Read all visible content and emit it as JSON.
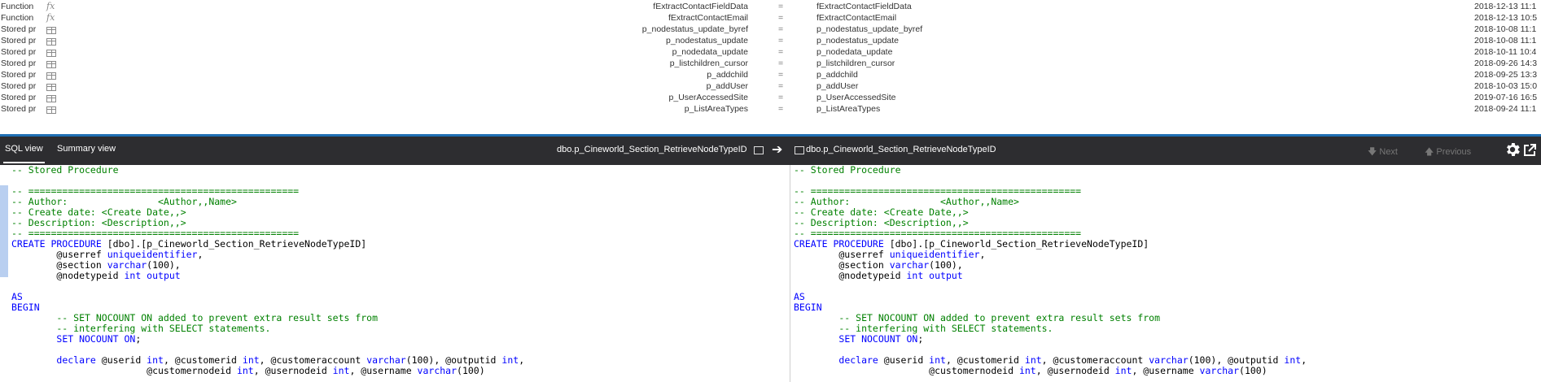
{
  "object_list": {
    "rows": [
      {
        "type": "Function",
        "icon": "fx",
        "left": "fExtractContactFieldData",
        "eq": "=",
        "right": "fExtractContactFieldData",
        "date": "2018-12-13 11:1"
      },
      {
        "type": "Function",
        "icon": "fx",
        "left": "fExtractContactEmail",
        "eq": "=",
        "right": "fExtractContactEmail",
        "date": "2018-12-13 10:5"
      },
      {
        "type": "Stored pr",
        "icon": "table",
        "left": "p_nodestatus_update_byref",
        "eq": "=",
        "right": "p_nodestatus_update_byref",
        "date": "2018-10-08 11:1"
      },
      {
        "type": "Stored pr",
        "icon": "table",
        "left": "p_nodestatus_update",
        "eq": "=",
        "right": "p_nodestatus_update",
        "date": "2018-10-08 11:1"
      },
      {
        "type": "Stored pr",
        "icon": "table",
        "left": "p_nodedata_update",
        "eq": "=",
        "right": "p_nodedata_update",
        "date": "2018-10-11 10:4"
      },
      {
        "type": "Stored pr",
        "icon": "table",
        "left": "p_listchildren_cursor",
        "eq": "=",
        "right": "p_listchildren_cursor",
        "date": "2018-09-26 14:3"
      },
      {
        "type": "Stored pr",
        "icon": "table",
        "left": "p_addchild",
        "eq": "=",
        "right": "p_addchild",
        "date": "2018-09-25 13:3"
      },
      {
        "type": "Stored pr",
        "icon": "table",
        "left": "p_addUser",
        "eq": "=",
        "right": "p_addUser",
        "date": "2018-10-03 15:0"
      },
      {
        "type": "Stored pr",
        "icon": "table",
        "left": "p_UserAccessedSite",
        "eq": "=",
        "right": "p_UserAccessedSite",
        "date": "2019-07-16 16:5"
      },
      {
        "type": "Stored pr",
        "icon": "table",
        "left": "p_ListAreaTypes",
        "eq": "=",
        "right": "p_ListAreaTypes",
        "date": "2018-09-24 11:1"
      }
    ]
  },
  "toolbar": {
    "tab_sql": "SQL view",
    "tab_summary": "Summary view",
    "left_object": "dbo.p_Cineworld_Section_RetrieveNodeTypeID",
    "right_object": "dbo.p_Cineworld_Section_RetrieveNodeTypeID",
    "next_label": "Next",
    "previous_label": "Previous"
  },
  "code_lines": [
    [
      {
        "t": "-- Stored Procedure",
        "c": "cm"
      }
    ],
    [
      {
        "t": "",
        "c": ""
      }
    ],
    [
      {
        "t": "-- ================================================",
        "c": "cm"
      }
    ],
    [
      {
        "t": "-- Author:\t\t<Author,,Name>",
        "c": "cm"
      }
    ],
    [
      {
        "t": "-- Create date: <Create Date,,>",
        "c": "cm"
      }
    ],
    [
      {
        "t": "-- Description: <Description,,>",
        "c": "cm"
      }
    ],
    [
      {
        "t": "-- ================================================",
        "c": "cm"
      }
    ],
    [
      {
        "t": "CREATE PROCEDURE",
        "c": "kw"
      },
      {
        "t": " [dbo].[p_Cineworld_Section_RetrieveNodeTypeID]",
        "c": ""
      }
    ],
    [
      {
        "t": "\t@userref ",
        "c": ""
      },
      {
        "t": "uniqueidentifier",
        "c": "kw"
      },
      {
        "t": ",",
        "c": ""
      }
    ],
    [
      {
        "t": "\t@section ",
        "c": ""
      },
      {
        "t": "varchar",
        "c": "kw"
      },
      {
        "t": "(100),",
        "c": ""
      }
    ],
    [
      {
        "t": "\t@nodetypeid ",
        "c": ""
      },
      {
        "t": "int output",
        "c": "kw"
      }
    ],
    [
      {
        "t": "",
        "c": ""
      }
    ],
    [
      {
        "t": "AS",
        "c": "kw"
      }
    ],
    [
      {
        "t": "BEGIN",
        "c": "kw"
      }
    ],
    [
      {
        "t": "\t-- SET NOCOUNT ON added to prevent extra result sets from",
        "c": "cm"
      }
    ],
    [
      {
        "t": "\t-- interfering with SELECT statements.",
        "c": "cm"
      }
    ],
    [
      {
        "t": "\t",
        "c": ""
      },
      {
        "t": "SET NOCOUNT ON",
        "c": "kw"
      },
      {
        "t": ";",
        "c": ""
      }
    ],
    [
      {
        "t": "",
        "c": ""
      }
    ],
    [
      {
        "t": "\t",
        "c": ""
      },
      {
        "t": "declare",
        "c": "kw"
      },
      {
        "t": " @userid ",
        "c": ""
      },
      {
        "t": "int",
        "c": "kw"
      },
      {
        "t": ", @customerid ",
        "c": ""
      },
      {
        "t": "int",
        "c": "kw"
      },
      {
        "t": ", @customeraccount ",
        "c": ""
      },
      {
        "t": "varchar",
        "c": "kw"
      },
      {
        "t": "(100), @outputid ",
        "c": ""
      },
      {
        "t": "int",
        "c": "kw"
      },
      {
        "t": ",",
        "c": ""
      }
    ],
    [
      {
        "t": "\t\t\t@customernodeid ",
        "c": ""
      },
      {
        "t": "int",
        "c": "kw"
      },
      {
        "t": ", @usernodeid ",
        "c": ""
      },
      {
        "t": "int",
        "c": "kw"
      },
      {
        "t": ", @username ",
        "c": ""
      },
      {
        "t": "varchar",
        "c": "kw"
      },
      {
        "t": "(100)",
        "c": ""
      }
    ]
  ],
  "colors": {
    "keyword": "#0000ff",
    "comment": "#008000",
    "toolbar_bg": "#2d2d30",
    "accent": "#1f6fb3"
  },
  "icons": {
    "gear": "gear-icon",
    "popout": "popout-icon",
    "arrow": "arrow-right-icon",
    "next": "arrow-down-icon",
    "previous": "arrow-up-icon"
  }
}
